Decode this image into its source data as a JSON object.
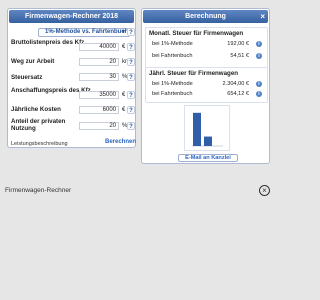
{
  "left_panel": {
    "title": "Firmenwagen-Rechner 2018",
    "method_select": "1%-Methode vs. Fahrtenbuch",
    "help_label": "?",
    "fields": [
      {
        "label": "Bruttolistenpreis des Kfz",
        "value": "40000",
        "unit": "€"
      },
      {
        "label": "Weg zur Arbeit",
        "value": "20",
        "unit": "km"
      },
      {
        "label": "Steuersatz",
        "value": "30",
        "unit": "%"
      },
      {
        "label": "Anschaffungspreis des Kfz",
        "value": "35000",
        "unit": "€"
      },
      {
        "label": "Jährliche Kosten",
        "value": "6000",
        "unit": "€"
      },
      {
        "label": "Anteil der privaten Nutzung",
        "value": "20",
        "unit": "%"
      }
    ],
    "description_link": "Leistungsbeschreibung",
    "calculate_button": "Berechnen"
  },
  "right_panel": {
    "title": "Berechnung",
    "close_label": "×",
    "monthly": {
      "title": "Monatl. Steuer für Firmenwagen",
      "rows": [
        {
          "label": "bei 1%-Methode",
          "value": "192,00 €"
        },
        {
          "label": "bei Fahrtenbuch",
          "value": "54,51 €"
        }
      ]
    },
    "yearly": {
      "title": "Jährl. Steuer für Firmenwagen",
      "rows": [
        {
          "label": "bei 1%-Methode",
          "value": "2.304,00 €"
        },
        {
          "label": "bei Fahrtenbuch",
          "value": "654,12 €"
        }
      ]
    },
    "info_label": "i",
    "email_button": "E-Mail an Kanzlei"
  },
  "chart_data": {
    "type": "bar",
    "categories": [
      "",
      ""
    ],
    "values": [
      2304,
      654.12
    ],
    "title": "",
    "xlabel": "",
    "ylabel": "",
    "ylim": [
      0,
      2500
    ],
    "colors": [
      "#2f5fa8",
      "#2f5fa8"
    ]
  },
  "footer": {
    "title": "Firmenwagen-Rechner",
    "close_icon": "×"
  }
}
